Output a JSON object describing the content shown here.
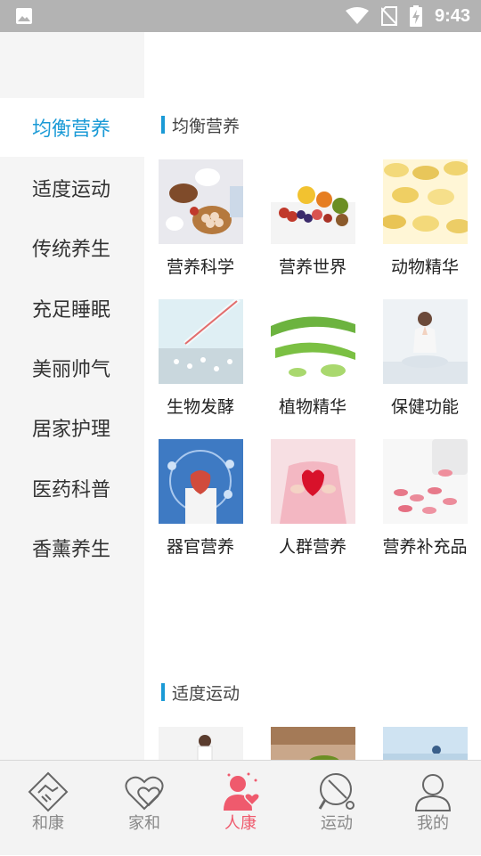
{
  "status": {
    "time": "9:43"
  },
  "sidebar": {
    "items": [
      {
        "label": "均衡营养"
      },
      {
        "label": "适度运动"
      },
      {
        "label": "传统养生"
      },
      {
        "label": "充足睡眠"
      },
      {
        "label": "美丽帅气"
      },
      {
        "label": "居家护理"
      },
      {
        "label": "医药科普"
      },
      {
        "label": "香薰养生"
      }
    ],
    "active_index": 0
  },
  "sections": [
    {
      "title": "均衡营养",
      "tiles": [
        {
          "label": "营养科学"
        },
        {
          "label": "营养世界"
        },
        {
          "label": "动物精华"
        },
        {
          "label": "生物发酵"
        },
        {
          "label": "植物精华"
        },
        {
          "label": "保健功能"
        },
        {
          "label": "器官营养"
        },
        {
          "label": "人群营养"
        },
        {
          "label": "营养补充品"
        }
      ]
    },
    {
      "title": "适度运动",
      "tiles": []
    }
  ],
  "bottom_nav": {
    "items": [
      {
        "label": "和康",
        "icon": "handshake-diamond-icon"
      },
      {
        "label": "家和",
        "icon": "double-heart-icon"
      },
      {
        "label": "人康",
        "icon": "person-heart-icon"
      },
      {
        "label": "运动",
        "icon": "ping-pong-icon"
      },
      {
        "label": "我的",
        "icon": "user-icon"
      }
    ],
    "active_index": 2
  },
  "colors": {
    "accent": "#1a9ad6",
    "nav_active": "#ef5a6d",
    "nav_inactive": "#888888"
  }
}
